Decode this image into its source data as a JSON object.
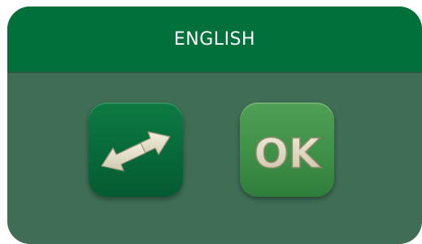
{
  "dialog": {
    "title": "ENGLISH"
  },
  "buttons": {
    "swap": {
      "icon": "swap-arrows-icon"
    },
    "ok": {
      "label": "OK"
    }
  },
  "colors": {
    "header": "#02703a",
    "body": "#3f6d55",
    "swap_button": "#07693a",
    "ok_button": "#3f9048",
    "glyph": "#e6e1cd"
  }
}
